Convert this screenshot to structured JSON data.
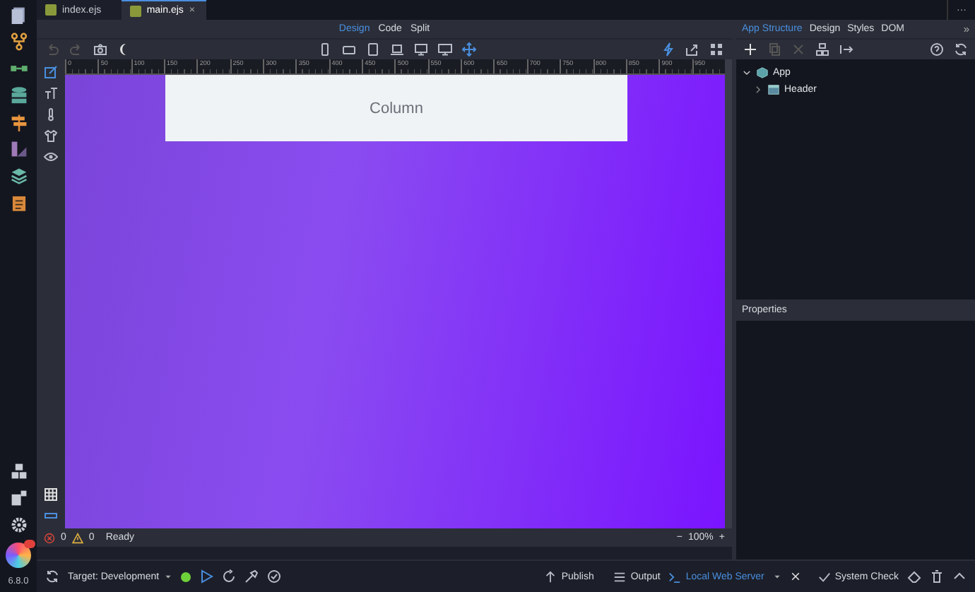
{
  "file_tabs": [
    {
      "label": "index.ejs",
      "selected": false
    },
    {
      "label": "main.ejs",
      "selected": true
    }
  ],
  "close_glyph": "×",
  "more_glyph": "···",
  "view_modes": [
    {
      "label": "Design",
      "selected": true
    },
    {
      "label": "Code",
      "selected": false
    },
    {
      "label": "Split",
      "selected": false
    }
  ],
  "panel_tabs": [
    {
      "label": "App Structure",
      "selected": true
    },
    {
      "label": "Design",
      "selected": false
    },
    {
      "label": "Styles",
      "selected": false
    },
    {
      "label": "DOM",
      "selected": false
    }
  ],
  "panel_more": "»",
  "ruler_labels": [
    "0",
    "50",
    "100",
    "150",
    "200",
    "250",
    "300",
    "350",
    "400",
    "450",
    "500",
    "550",
    "600",
    "650",
    "700",
    "750",
    "800",
    "850",
    "900",
    "950"
  ],
  "canvas": {
    "column_label": "Column"
  },
  "tree": [
    {
      "label": "App",
      "expanded": true,
      "children": [
        {
          "label": "Header",
          "expanded": false
        }
      ]
    }
  ],
  "properties_title": "Properties",
  "status": {
    "errors": "0",
    "warnings": "0",
    "message": "Ready",
    "zoom_out": "−",
    "zoom": "100%",
    "zoom_in": "+"
  },
  "version": "6.8.0",
  "bottom": {
    "target": "Target: Development",
    "server_running": true,
    "publish": "Publish",
    "output": "Output",
    "terminal": "Local Web Server",
    "system_check": "System Check"
  }
}
